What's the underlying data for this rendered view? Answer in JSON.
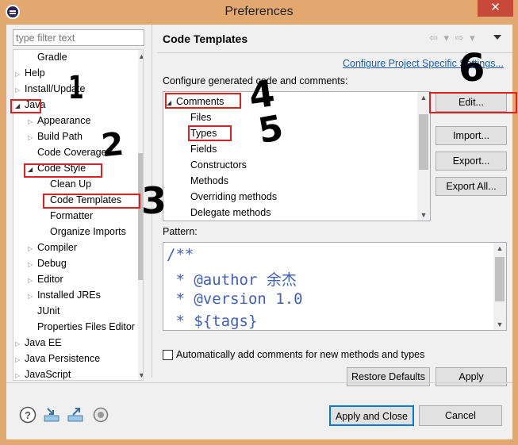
{
  "window": {
    "title": "Preferences",
    "close_glyph": "✕"
  },
  "filter": {
    "placeholder": "type filter text"
  },
  "tree": {
    "items": [
      {
        "label": "Gradle",
        "level": 1,
        "twisty": ""
      },
      {
        "label": "Help",
        "level": 0,
        "twisty": "closed"
      },
      {
        "label": "Install/Update",
        "level": 0,
        "twisty": "closed"
      },
      {
        "label": "Java",
        "level": 0,
        "twisty": "open"
      },
      {
        "label": "Appearance",
        "level": 1,
        "twisty": "closed"
      },
      {
        "label": "Build Path",
        "level": 1,
        "twisty": "closed"
      },
      {
        "label": "Code Coverage",
        "level": 1,
        "twisty": ""
      },
      {
        "label": "Code Style",
        "level": 1,
        "twisty": "open"
      },
      {
        "label": "Clean Up",
        "level": 2,
        "twisty": ""
      },
      {
        "label": "Code Templates",
        "level": 2,
        "twisty": ""
      },
      {
        "label": "Formatter",
        "level": 2,
        "twisty": ""
      },
      {
        "label": "Organize Imports",
        "level": 2,
        "twisty": ""
      },
      {
        "label": "Compiler",
        "level": 1,
        "twisty": "closed"
      },
      {
        "label": "Debug",
        "level": 1,
        "twisty": "closed"
      },
      {
        "label": "Editor",
        "level": 1,
        "twisty": "closed"
      },
      {
        "label": "Installed JREs",
        "level": 1,
        "twisty": "closed"
      },
      {
        "label": "JUnit",
        "level": 1,
        "twisty": ""
      },
      {
        "label": "Properties Files Editor",
        "level": 1,
        "twisty": ""
      },
      {
        "label": "Java EE",
        "level": 0,
        "twisty": "closed"
      },
      {
        "label": "Java Persistence",
        "level": 0,
        "twisty": "closed"
      },
      {
        "label": "JavaScript",
        "level": 0,
        "twisty": "closed"
      }
    ]
  },
  "page": {
    "title": "Code Templates",
    "configure_link": "Configure Project Specific Settings...",
    "configure_label": "Configure generated code and comments:",
    "templates": [
      {
        "label": "Comments",
        "level": 0,
        "twisty": "open"
      },
      {
        "label": "Files",
        "level": 1,
        "twisty": ""
      },
      {
        "label": "Types",
        "level": 1,
        "twisty": ""
      },
      {
        "label": "Fields",
        "level": 1,
        "twisty": ""
      },
      {
        "label": "Constructors",
        "level": 1,
        "twisty": ""
      },
      {
        "label": "Methods",
        "level": 1,
        "twisty": ""
      },
      {
        "label": "Overriding methods",
        "level": 1,
        "twisty": ""
      },
      {
        "label": "Delegate methods",
        "level": 1,
        "twisty": ""
      }
    ],
    "buttons": {
      "edit": "Edit...",
      "import": "Import...",
      "export": "Export...",
      "export_all": "Export All..."
    },
    "pattern_label": "Pattern:",
    "pattern_lines": [
      "/**",
      " * @author 余杰",
      " * @version 1.0",
      " * ${tags}"
    ],
    "auto_comment_label": "Automatically add comments for new methods and types",
    "auto_comment_checked": false,
    "restore_defaults": "Restore Defaults",
    "apply": "Apply"
  },
  "footer": {
    "apply_close": "Apply and Close",
    "cancel": "Cancel"
  },
  "annotations": [
    "1",
    "2",
    "3",
    "4",
    "5",
    "6"
  ]
}
